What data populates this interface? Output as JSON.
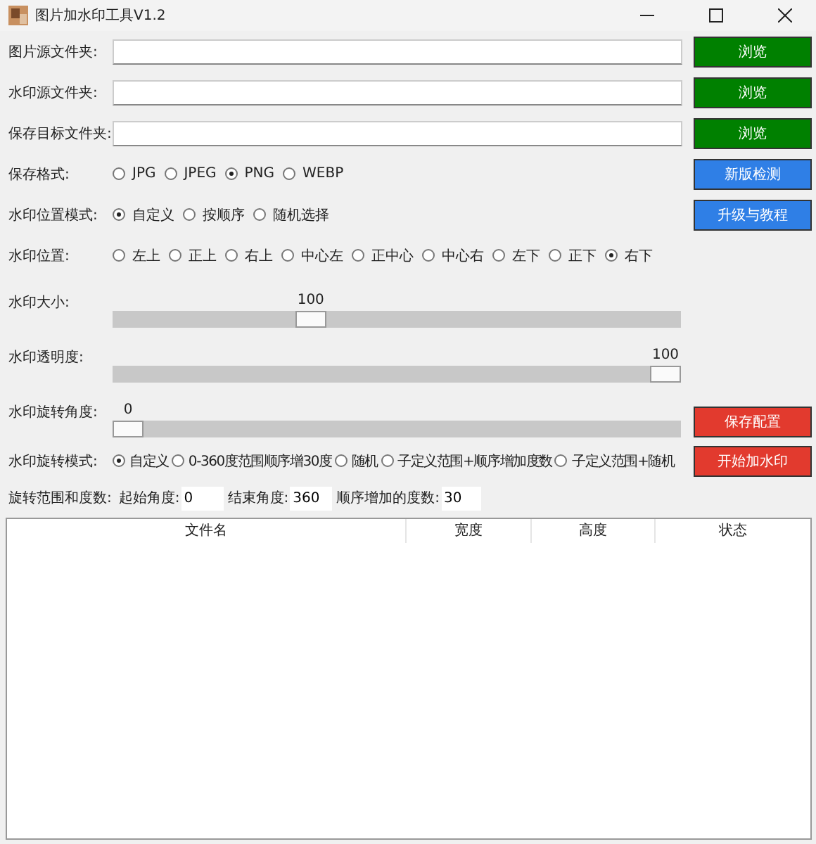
{
  "window": {
    "title": "图片加水印工具V1.2"
  },
  "folders": [
    {
      "label": "图片源文件夹:",
      "button": "浏览"
    },
    {
      "label": "水印源文件夹:",
      "button": "浏览"
    },
    {
      "label": "保存目标文件夹:",
      "button": "浏览"
    }
  ],
  "format": {
    "label": "保存格式:",
    "options": [
      {
        "label": "JPG",
        "selected": false
      },
      {
        "label": "JPEG",
        "selected": false
      },
      {
        "label": "PNG",
        "selected": true
      },
      {
        "label": "WEBP",
        "selected": false
      }
    ],
    "button": "新版检测"
  },
  "position_mode": {
    "label": "水印位置模式:",
    "options": [
      {
        "label": "自定义",
        "selected": true
      },
      {
        "label": "按顺序",
        "selected": false
      },
      {
        "label": "随机选择",
        "selected": false
      }
    ],
    "button": "升级与教程"
  },
  "position": {
    "label": "水印位置:",
    "options": [
      {
        "label": "左上",
        "selected": false
      },
      {
        "label": "正上",
        "selected": false
      },
      {
        "label": "右上",
        "selected": false
      },
      {
        "label": "中心左",
        "selected": false
      },
      {
        "label": "正中心",
        "selected": false
      },
      {
        "label": "中心右",
        "selected": false
      },
      {
        "label": "左下",
        "selected": false
      },
      {
        "label": "正下",
        "selected": false
      },
      {
        "label": "右下",
        "selected": true
      }
    ]
  },
  "sliders": [
    {
      "label": "水印大小:",
      "reading": "100",
      "level": 0.34
    },
    {
      "label": "水印透明度:",
      "reading": "100",
      "level": 1
    },
    {
      "label": "水印旋转角度:",
      "reading": "0",
      "level": 0,
      "button": "保存配置"
    }
  ],
  "rotation_mode": {
    "label": "水印旋转模式:",
    "options": [
      {
        "label": "自定义",
        "selected": true
      },
      {
        "label": "0-360度范围顺序增30度",
        "selected": false
      },
      {
        "label": "随机",
        "selected": false
      },
      {
        "label": "子定义范围+顺序增加度数",
        "selected": false
      },
      {
        "label": "子定义范围+随机",
        "selected": false
      }
    ],
    "button": "开始加水印"
  },
  "rotation_range": {
    "label": "旋转范围和度数:",
    "fields": [
      {
        "label": "起始角度:",
        "value": "0"
      },
      {
        "label": "结束角度:",
        "value": "360"
      },
      {
        "label": "顺序增加的度数:",
        "value": "30"
      }
    ]
  },
  "table": {
    "columns": [
      "文件名",
      "宽度",
      "高度",
      "状态"
    ]
  }
}
